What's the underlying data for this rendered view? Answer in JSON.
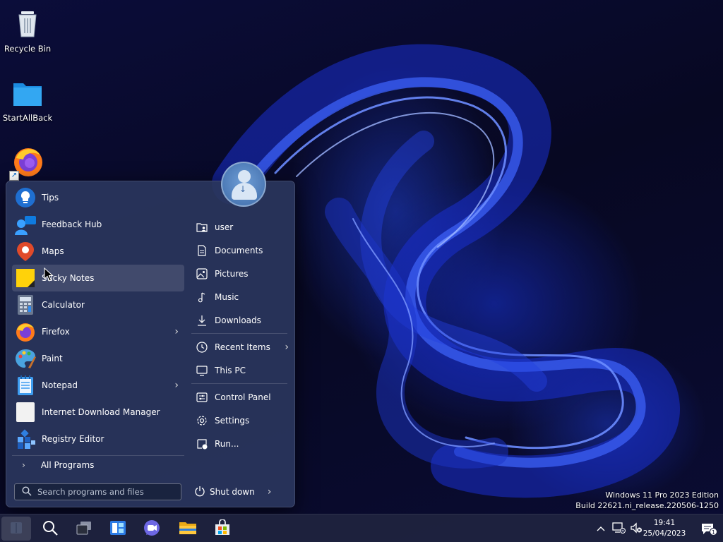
{
  "desktop": {
    "icons": [
      {
        "label": "Recycle Bin",
        "icon": "recycle-bin-icon"
      },
      {
        "label": "StartAllBack",
        "icon": "folder-icon"
      },
      {
        "label": "",
        "icon": "firefox-icon"
      }
    ]
  },
  "start_menu": {
    "apps": [
      {
        "label": "Tips",
        "icon": "tips-icon",
        "submenu": false
      },
      {
        "label": "Feedback Hub",
        "icon": "feedback-hub-icon",
        "submenu": false
      },
      {
        "label": "Maps",
        "icon": "maps-icon",
        "submenu": false
      },
      {
        "label": "Sticky Notes",
        "icon": "sticky-notes-icon",
        "submenu": false
      },
      {
        "label": "Calculator",
        "icon": "calculator-icon",
        "submenu": false
      },
      {
        "label": "Firefox",
        "icon": "firefox-icon",
        "submenu": true
      },
      {
        "label": "Paint",
        "icon": "paint-icon",
        "submenu": false
      },
      {
        "label": "Notepad",
        "icon": "notepad-icon",
        "submenu": true
      },
      {
        "label": "Internet Download Manager",
        "icon": "idm-icon",
        "submenu": false
      },
      {
        "label": "Registry Editor",
        "icon": "registry-editor-icon",
        "submenu": false
      }
    ],
    "all_programs": "All Programs",
    "search_placeholder": "Search programs and files",
    "places": [
      {
        "label": "user",
        "icon": "user-folder-icon"
      },
      {
        "label": "Documents",
        "icon": "document-icon"
      },
      {
        "label": "Pictures",
        "icon": "picture-icon"
      },
      {
        "label": "Music",
        "icon": "music-note-icon"
      },
      {
        "label": "Downloads",
        "icon": "download-icon"
      },
      {
        "label": "Recent Items",
        "icon": "clock-icon"
      },
      {
        "label": "This PC",
        "icon": "monitor-icon"
      },
      {
        "label": "Control Panel",
        "icon": "control-panel-icon"
      },
      {
        "label": "Settings",
        "icon": "gear-icon"
      },
      {
        "label": "Run...",
        "icon": "run-icon"
      }
    ],
    "shutdown": "Shut down"
  },
  "watermark": {
    "line1": "Windows 11 Pro 2023 Edition",
    "line2": "Build 22621.ni_release.220506-1250"
  },
  "taskbar": {
    "time": "19:41",
    "date": "25/04/2023",
    "notification_count": "1"
  }
}
